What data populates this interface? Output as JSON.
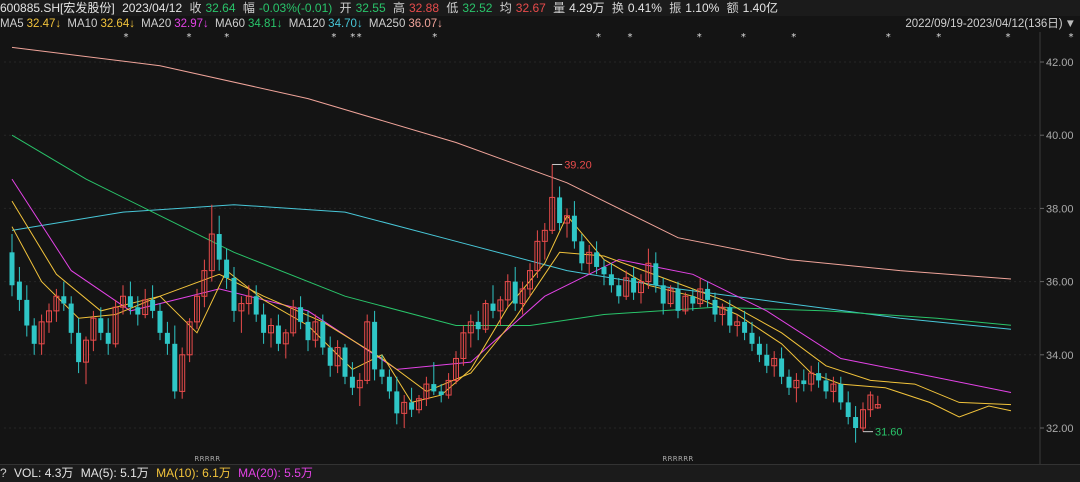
{
  "header": {
    "symbol": "600885.SH[宏发股份]",
    "date": "2023/04/12",
    "close_label": "收",
    "close": "32.64",
    "change_label": "幅",
    "change": "-0.03%(-0.01)",
    "open_label": "开",
    "open": "32.55",
    "high_label": "高",
    "high": "32.88",
    "low_label": "低",
    "low": "32.52",
    "avg_label": "均",
    "avg": "32.67",
    "vol_label": "量",
    "vol": "4.29万",
    "turnover_label": "换",
    "turnover": "0.41%",
    "amplitude_label": "振",
    "amplitude": "1.10%",
    "amount_label": "额",
    "amount": "1.40亿"
  },
  "ma_legend": [
    {
      "name": "MA5",
      "value": "32.47↓",
      "color": "#f2c33b"
    },
    {
      "name": "MA10",
      "value": "32.64↓",
      "color": "#f2c33b"
    },
    {
      "name": "MA20",
      "value": "32.97↓",
      "color": "#e343e6"
    },
    {
      "name": "MA60",
      "value": "34.81↓",
      "color": "#29c46a"
    },
    {
      "name": "MA120",
      "value": "34.70↓",
      "color": "#48c7d8"
    },
    {
      "name": "MA250",
      "value": "36.07↓",
      "color": "#f0a49a"
    }
  ],
  "range": "2022/09/19-2023/04/12(136日)",
  "volume_bar": {
    "question": "?",
    "vol": "VOL: 4.3万",
    "ma5": "MA(5): 5.1万",
    "ma10": "MA(10): 6.1万",
    "ma20": "MA(20): 5.5万"
  },
  "colors": {
    "up": "#e84b4b",
    "down": "#2fc6c6",
    "bg": "#141414",
    "grid": "#262626"
  },
  "chart_data": {
    "type": "candlestick",
    "y_ticks": [
      "42.00",
      "40.00",
      "38.00",
      "36.00",
      "34.00",
      "32.00"
    ],
    "ylim": [
      31.3,
      42.8
    ],
    "annotations": [
      {
        "label": "39.20",
        "kind": "high",
        "index": 73
      },
      {
        "label": "31.60",
        "kind": "low",
        "index": 115
      }
    ],
    "candles": [
      [
        36.8,
        37.3,
        35.6,
        35.9
      ],
      [
        36.0,
        36.4,
        35.2,
        35.5
      ],
      [
        35.5,
        35.9,
        34.5,
        34.8
      ],
      [
        34.8,
        35.0,
        34.0,
        34.3
      ],
      [
        34.3,
        35.1,
        34.0,
        34.9
      ],
      [
        34.9,
        35.4,
        34.6,
        35.2
      ],
      [
        35.2,
        35.8,
        34.9,
        35.6
      ],
      [
        35.6,
        36.0,
        35.2,
        35.4
      ],
      [
        35.4,
        35.6,
        34.3,
        34.6
      ],
      [
        34.6,
        35.0,
        33.5,
        33.8
      ],
      [
        33.8,
        34.5,
        33.2,
        34.4
      ],
      [
        34.4,
        35.2,
        34.1,
        35.0
      ],
      [
        35.0,
        35.3,
        34.4,
        34.6
      ],
      [
        34.6,
        35.0,
        34.0,
        34.3
      ],
      [
        34.3,
        35.5,
        34.2,
        35.3
      ],
      [
        35.3,
        35.9,
        35.1,
        35.6
      ],
      [
        35.6,
        36.0,
        35.1,
        35.3
      ],
      [
        35.3,
        35.6,
        34.8,
        35.1
      ],
      [
        35.1,
        35.8,
        35.0,
        35.5
      ],
      [
        35.5,
        35.9,
        35.0,
        35.2
      ],
      [
        35.2,
        35.4,
        34.4,
        34.6
      ],
      [
        34.6,
        34.9,
        34.0,
        34.3
      ],
      [
        34.3,
        34.8,
        32.8,
        33.0
      ],
      [
        33.0,
        34.2,
        32.8,
        34.0
      ],
      [
        34.0,
        35.0,
        33.8,
        34.9
      ],
      [
        34.9,
        35.8,
        34.7,
        35.6
      ],
      [
        35.6,
        36.6,
        35.3,
        36.3
      ],
      [
        36.3,
        38.1,
        36.0,
        37.3
      ],
      [
        37.3,
        37.8,
        36.3,
        36.6
      ],
      [
        36.6,
        36.9,
        35.8,
        36.1
      ],
      [
        36.1,
        36.4,
        34.9,
        35.2
      ],
      [
        35.2,
        35.6,
        34.6,
        35.4
      ],
      [
        35.4,
        35.9,
        35.1,
        35.6
      ],
      [
        35.6,
        35.9,
        34.9,
        35.1
      ],
      [
        35.1,
        35.4,
        34.3,
        34.6
      ],
      [
        34.6,
        35.0,
        34.2,
        34.8
      ],
      [
        34.8,
        35.1,
        34.1,
        34.3
      ],
      [
        34.3,
        34.7,
        33.9,
        34.6
      ],
      [
        34.6,
        35.5,
        34.5,
        35.3
      ],
      [
        35.3,
        35.6,
        34.7,
        34.9
      ],
      [
        34.9,
        35.2,
        34.1,
        34.4
      ],
      [
        34.4,
        35.1,
        34.2,
        34.9
      ],
      [
        34.9,
        35.1,
        34.0,
        34.2
      ],
      [
        34.2,
        34.5,
        33.4,
        33.7
      ],
      [
        33.7,
        34.4,
        33.5,
        34.2
      ],
      [
        34.2,
        34.3,
        33.2,
        33.4
      ],
      [
        33.4,
        33.8,
        32.9,
        33.1
      ],
      [
        33.1,
        33.5,
        32.6,
        33.3
      ],
      [
        33.3,
        35.1,
        33.2,
        34.9
      ],
      [
        34.9,
        35.2,
        33.3,
        33.6
      ],
      [
        33.6,
        34.0,
        33.2,
        33.4
      ],
      [
        33.4,
        33.6,
        32.8,
        33.0
      ],
      [
        33.0,
        33.4,
        32.1,
        32.4
      ],
      [
        32.4,
        32.9,
        32.0,
        32.7
      ],
      [
        32.7,
        33.1,
        32.3,
        32.5
      ],
      [
        32.5,
        32.9,
        32.4,
        32.8
      ],
      [
        32.8,
        33.4,
        32.6,
        33.2
      ],
      [
        33.2,
        33.8,
        32.9,
        33.0
      ],
      [
        33.0,
        33.2,
        32.7,
        32.9
      ],
      [
        32.9,
        33.5,
        32.8,
        33.3
      ],
      [
        33.3,
        34.1,
        33.2,
        33.9
      ],
      [
        33.9,
        34.8,
        33.7,
        34.6
      ],
      [
        34.6,
        35.1,
        34.2,
        34.9
      ],
      [
        34.9,
        35.2,
        34.4,
        34.7
      ],
      [
        34.7,
        35.5,
        34.6,
        35.4
      ],
      [
        35.4,
        35.9,
        35.0,
        35.2
      ],
      [
        35.2,
        35.6,
        34.8,
        35.5
      ],
      [
        35.5,
        36.2,
        35.3,
        36.0
      ],
      [
        36.0,
        36.4,
        35.2,
        35.4
      ],
      [
        35.4,
        36.0,
        35.1,
        35.8
      ],
      [
        35.8,
        36.5,
        35.6,
        36.3
      ],
      [
        36.3,
        37.4,
        36.1,
        37.1
      ],
      [
        37.1,
        37.6,
        36.6,
        37.4
      ],
      [
        37.4,
        39.2,
        37.3,
        38.3
      ],
      [
        38.3,
        38.6,
        37.4,
        37.6
      ],
      [
        37.6,
        38.0,
        37.2,
        37.8
      ],
      [
        37.8,
        38.2,
        36.9,
        37.1
      ],
      [
        37.1,
        37.3,
        36.3,
        36.5
      ],
      [
        36.5,
        37.0,
        36.2,
        36.8
      ],
      [
        36.8,
        37.1,
        36.2,
        36.4
      ],
      [
        36.4,
        36.6,
        35.9,
        36.2
      ],
      [
        36.2,
        36.5,
        35.7,
        35.9
      ],
      [
        35.9,
        36.1,
        35.4,
        35.6
      ],
      [
        35.6,
        36.3,
        35.5,
        36.1
      ],
      [
        36.1,
        36.4,
        35.5,
        35.7
      ],
      [
        35.7,
        36.2,
        35.4,
        36.0
      ],
      [
        36.0,
        36.9,
        35.8,
        36.5
      ],
      [
        36.5,
        36.8,
        35.7,
        35.9
      ],
      [
        35.9,
        36.1,
        35.1,
        35.4
      ],
      [
        35.4,
        35.9,
        35.3,
        35.8
      ],
      [
        35.8,
        36.0,
        35.0,
        35.2
      ],
      [
        35.2,
        35.7,
        35.1,
        35.6
      ],
      [
        35.6,
        35.8,
        35.2,
        35.4
      ],
      [
        35.4,
        36.1,
        35.3,
        35.8
      ],
      [
        35.8,
        36.0,
        35.3,
        35.5
      ],
      [
        35.5,
        35.7,
        34.9,
        35.1
      ],
      [
        35.1,
        35.4,
        34.8,
        35.3
      ],
      [
        35.3,
        35.5,
        34.6,
        34.8
      ],
      [
        34.8,
        35.1,
        34.5,
        34.9
      ],
      [
        34.9,
        35.2,
        34.4,
        34.6
      ],
      [
        34.6,
        34.9,
        34.1,
        34.3
      ],
      [
        34.3,
        34.5,
        33.8,
        34.0
      ],
      [
        34.0,
        34.3,
        33.5,
        33.7
      ],
      [
        33.7,
        34.1,
        33.4,
        33.9
      ],
      [
        33.9,
        34.2,
        33.2,
        33.4
      ],
      [
        33.4,
        33.6,
        32.9,
        33.1
      ],
      [
        33.1,
        33.5,
        32.7,
        33.3
      ],
      [
        33.3,
        33.6,
        33.0,
        33.2
      ],
      [
        33.2,
        33.7,
        33.0,
        33.5
      ],
      [
        33.5,
        33.8,
        33.1,
        33.3
      ],
      [
        33.3,
        33.5,
        32.8,
        33.0
      ],
      [
        33.0,
        33.4,
        32.7,
        33.2
      ],
      [
        33.2,
        33.4,
        32.5,
        32.7
      ],
      [
        32.7,
        33.0,
        32.1,
        32.3
      ],
      [
        32.3,
        32.6,
        31.6,
        32.0
      ],
      [
        32.0,
        32.7,
        31.9,
        32.5
      ],
      [
        32.5,
        33.0,
        32.3,
        32.9
      ],
      [
        32.55,
        32.88,
        32.52,
        32.64
      ]
    ],
    "ma_lines": [
      {
        "name": "MA250",
        "color": "#f0a49a",
        "points": [
          [
            0,
            42.4
          ],
          [
            20,
            41.9
          ],
          [
            40,
            41.0
          ],
          [
            60,
            39.8
          ],
          [
            75,
            38.7
          ],
          [
            90,
            37.2
          ],
          [
            105,
            36.6
          ],
          [
            120,
            36.3
          ],
          [
            135,
            36.07
          ]
        ]
      },
      {
        "name": "MA120",
        "color": "#48c7d8",
        "points": [
          [
            0,
            37.4
          ],
          [
            15,
            37.9
          ],
          [
            30,
            38.1
          ],
          [
            45,
            37.9
          ],
          [
            60,
            37.1
          ],
          [
            75,
            36.3
          ],
          [
            90,
            35.8
          ],
          [
            105,
            35.4
          ],
          [
            120,
            35.0
          ],
          [
            135,
            34.7
          ]
        ]
      },
      {
        "name": "MA60",
        "color": "#29c46a",
        "points": [
          [
            0,
            40.0
          ],
          [
            10,
            38.8
          ],
          [
            20,
            37.8
          ],
          [
            30,
            36.8
          ],
          [
            45,
            35.6
          ],
          [
            60,
            34.8
          ],
          [
            70,
            34.8
          ],
          [
            80,
            35.1
          ],
          [
            95,
            35.3
          ],
          [
            110,
            35.2
          ],
          [
            125,
            35.0
          ],
          [
            135,
            34.81
          ]
        ]
      },
      {
        "name": "MA20",
        "color": "#e343e6",
        "points": [
          [
            0,
            38.8
          ],
          [
            8,
            36.3
          ],
          [
            16,
            35.2
          ],
          [
            28,
            35.8
          ],
          [
            40,
            35.2
          ],
          [
            52,
            33.6
          ],
          [
            62,
            33.8
          ],
          [
            72,
            35.6
          ],
          [
            82,
            36.6
          ],
          [
            92,
            36.2
          ],
          [
            102,
            35.2
          ],
          [
            112,
            33.9
          ],
          [
            122,
            33.5
          ],
          [
            135,
            32.97
          ]
        ]
      },
      {
        "name": "MA10",
        "color": "#f2c33b",
        "points": [
          [
            0,
            38.2
          ],
          [
            6,
            36.2
          ],
          [
            12,
            35.2
          ],
          [
            20,
            35.6
          ],
          [
            28,
            36.2
          ],
          [
            34,
            35.6
          ],
          [
            42,
            34.9
          ],
          [
            50,
            33.9
          ],
          [
            56,
            33.0
          ],
          [
            62,
            33.5
          ],
          [
            68,
            35.0
          ],
          [
            74,
            36.8
          ],
          [
            80,
            36.7
          ],
          [
            88,
            36.1
          ],
          [
            96,
            35.5
          ],
          [
            104,
            34.6
          ],
          [
            110,
            33.7
          ],
          [
            116,
            33.3
          ],
          [
            122,
            33.2
          ],
          [
            128,
            32.7
          ],
          [
            135,
            32.64
          ]
        ]
      },
      {
        "name": "MA5",
        "color": "#f2c33b",
        "points": [
          [
            0,
            37.5
          ],
          [
            4,
            36.0
          ],
          [
            9,
            35.0
          ],
          [
            14,
            35.1
          ],
          [
            20,
            35.6
          ],
          [
            25,
            34.6
          ],
          [
            29,
            36.3
          ],
          [
            34,
            35.5
          ],
          [
            40,
            34.8
          ],
          [
            46,
            33.6
          ],
          [
            50,
            34.0
          ],
          [
            54,
            32.7
          ],
          [
            58,
            32.9
          ],
          [
            62,
            33.6
          ],
          [
            67,
            35.3
          ],
          [
            72,
            36.5
          ],
          [
            75,
            37.8
          ],
          [
            80,
            36.6
          ],
          [
            86,
            35.9
          ],
          [
            92,
            35.6
          ],
          [
            98,
            35.1
          ],
          [
            104,
            34.3
          ],
          [
            108,
            33.5
          ],
          [
            112,
            33.2
          ],
          [
            118,
            33.1
          ],
          [
            124,
            32.7
          ],
          [
            128,
            32.3
          ],
          [
            132,
            32.6
          ],
          [
            135,
            32.47
          ]
        ]
      }
    ],
    "star_markers": [
      20,
      30,
      36,
      53,
      56,
      57,
      69,
      95,
      100,
      111,
      118,
      126,
      141,
      149,
      160,
      170
    ],
    "r_markers_left": [
      37,
      38,
      39,
      40,
      41
    ],
    "r_markers_right": [
      127,
      128,
      129,
      130,
      131,
      132
    ]
  }
}
